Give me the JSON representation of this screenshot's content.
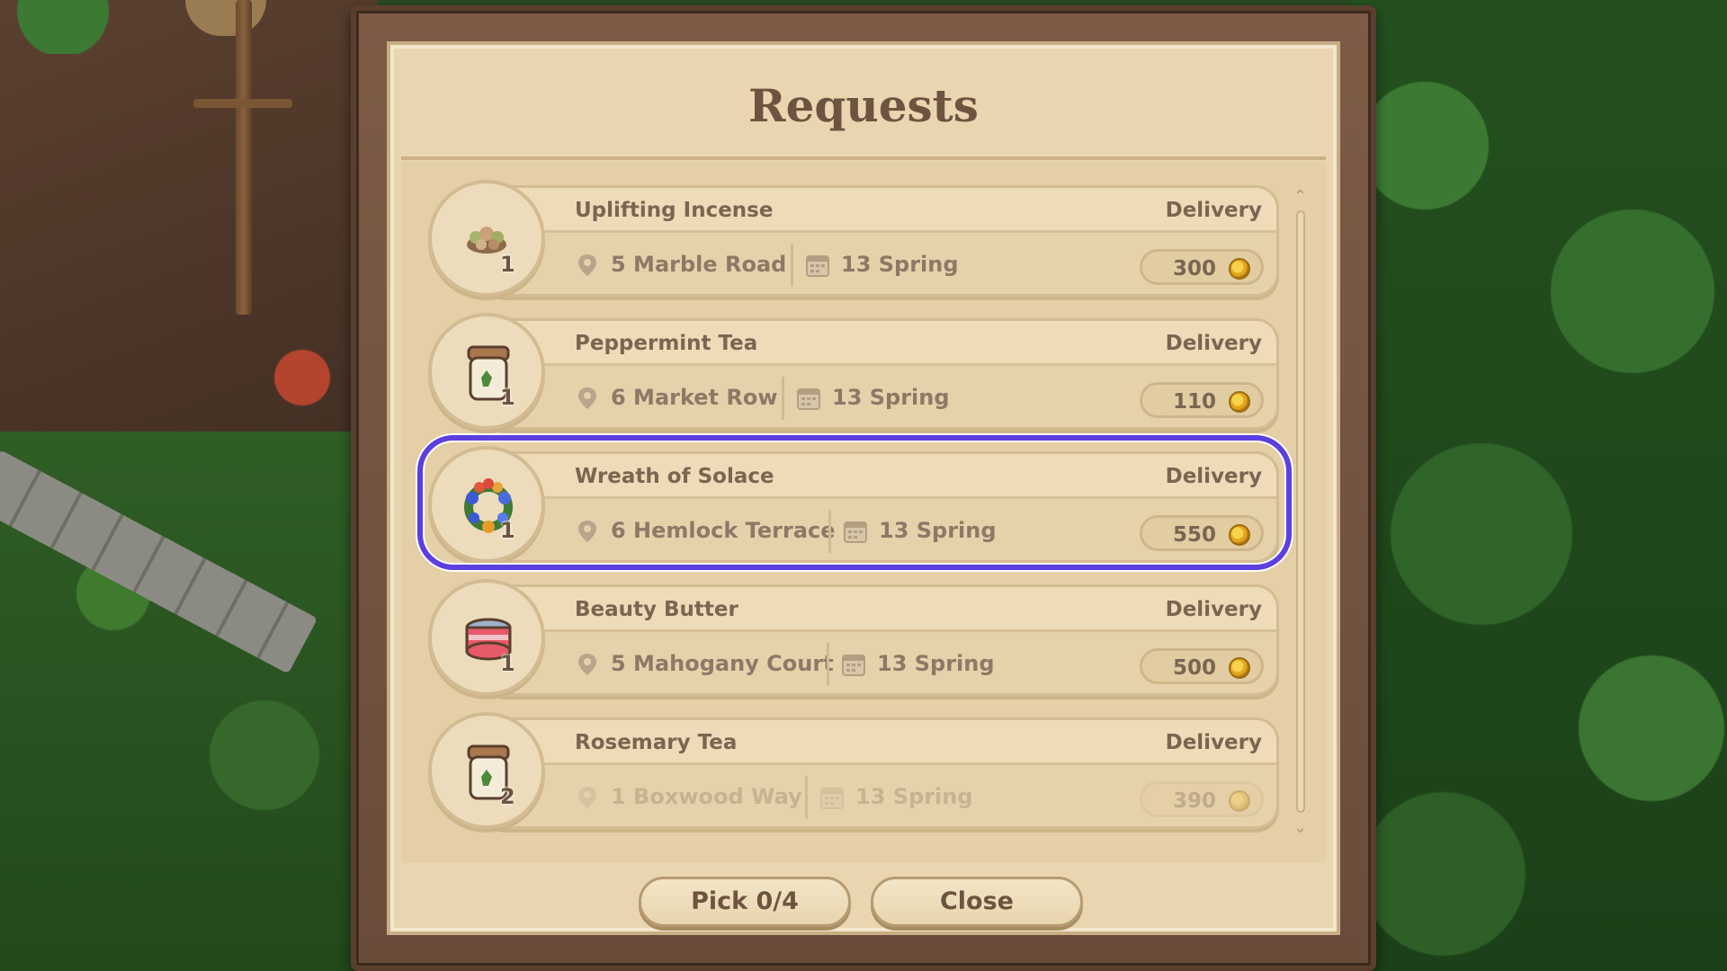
{
  "panel": {
    "title": "Requests"
  },
  "requests": [
    {
      "item": "Uplifting Incense",
      "type": "Delivery",
      "address": "5 Marble Road",
      "date": "13 Spring",
      "reward": "300",
      "quantity": "1",
      "icon": "incense-icon",
      "selected": false
    },
    {
      "item": "Peppermint Tea",
      "type": "Delivery",
      "address": "6 Market Row",
      "date": "13 Spring",
      "reward": "110",
      "quantity": "1",
      "icon": "tea-jar-icon",
      "selected": false
    },
    {
      "item": "Wreath of Solace",
      "type": "Delivery",
      "address": "6 Hemlock Terrace",
      "date": "13 Spring",
      "reward": "550",
      "quantity": "1",
      "icon": "wreath-icon",
      "selected": true
    },
    {
      "item": "Beauty Butter",
      "type": "Delivery",
      "address": "5 Mahogany Court",
      "date": "13 Spring",
      "reward": "500",
      "quantity": "1",
      "icon": "butter-jar-icon",
      "selected": false
    },
    {
      "item": "Rosemary Tea",
      "type": "Delivery",
      "address": "1 Boxwood Way",
      "date": "13 Spring",
      "reward": "390",
      "quantity": "2",
      "icon": "tea-jar-icon",
      "selected": false
    }
  ],
  "footer": {
    "pick_label": "Pick 0/4",
    "close_label": "Close"
  },
  "colors": {
    "selection_outline": "#5b3fe0",
    "parchment": "#e9d6b0",
    "frame": "#6a4c3b",
    "text": "#7b6552",
    "coin": "#e2a51c"
  }
}
